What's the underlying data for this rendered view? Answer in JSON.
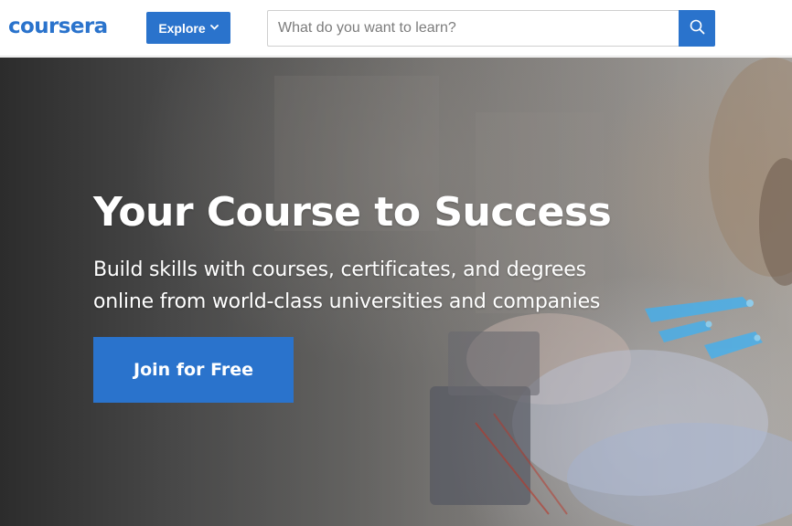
{
  "header": {
    "logo_text": "coursera",
    "explore_label": "Explore",
    "search": {
      "placeholder": "What do you want to learn?",
      "value": ""
    }
  },
  "hero": {
    "title": "Your Course to Success",
    "subtitle_line1": "Build skills with courses, certificates, and degrees",
    "subtitle_line2": "online from world-class universities and companies",
    "cta_label": "Join for Free"
  },
  "icons": {
    "explore_chevron": "chevron-down-icon",
    "search": "search-icon"
  },
  "colors": {
    "brand_blue": "#2a73cc",
    "header_bg": "#ffffff",
    "hero_text": "#ffffff"
  }
}
